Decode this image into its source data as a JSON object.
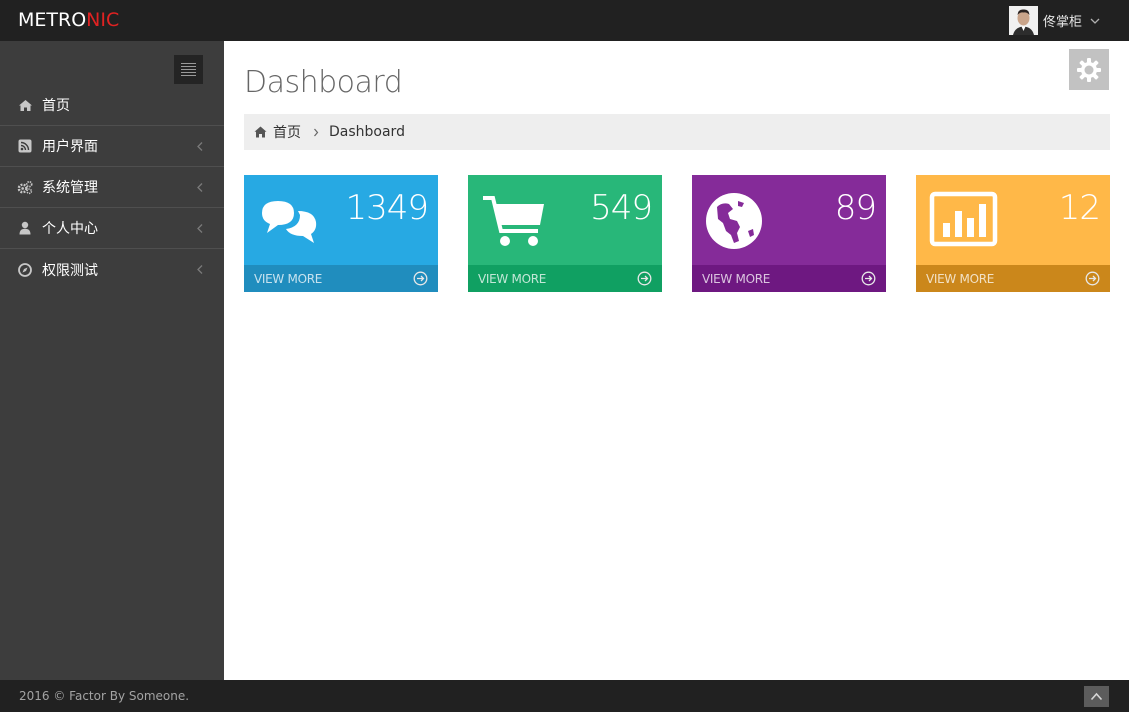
{
  "header": {
    "logo_main": "METRO",
    "logo_accent": "NIC",
    "username": "佟掌柜",
    "brand_accent_color": "#e02222"
  },
  "sidebar": {
    "toggler_icon": "hamburger-icon",
    "items": [
      {
        "label": "首页",
        "icon": "home-icon",
        "has_submenu": false
      },
      {
        "label": "用户界面",
        "icon": "rss-icon",
        "has_submenu": true
      },
      {
        "label": "系统管理",
        "icon": "cogs-icon",
        "has_submenu": true
      },
      {
        "label": "个人中心",
        "icon": "user-icon",
        "has_submenu": true
      },
      {
        "label": "权限测试",
        "icon": "compass-icon",
        "has_submenu": true
      }
    ]
  },
  "main": {
    "title": "Dashboard",
    "breadcrumb": {
      "home": "首页",
      "current": "Dashboard"
    },
    "stats": [
      {
        "value": "1349",
        "more": "VIEW MORE",
        "icon": "comments-icon",
        "color": "#27a9e3",
        "footer_color": "#208dbe"
      },
      {
        "value": "549",
        "more": "VIEW MORE",
        "icon": "shopping-cart-icon",
        "color": "#28b779",
        "footer_color": "#10a062"
      },
      {
        "value": "89",
        "more": "VIEW MORE",
        "icon": "globe-icon",
        "color": "#852b99",
        "footer_color": "#6e1881"
      },
      {
        "value": "12",
        "more": "VIEW MORE",
        "icon": "bar-chart-icon",
        "color": "#ffb848",
        "footer_color": "#cb871b"
      }
    ]
  },
  "footer": {
    "copyright": "2016 © Factor By Someone."
  }
}
